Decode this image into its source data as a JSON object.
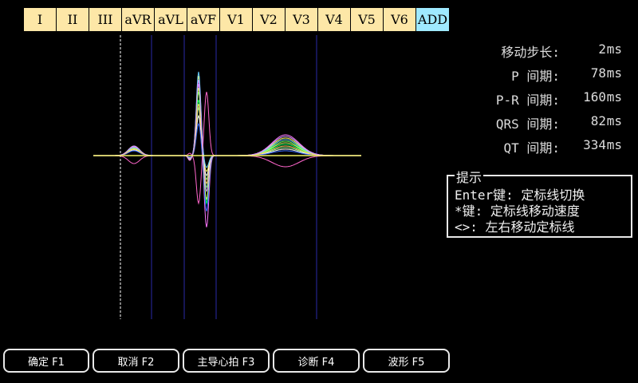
{
  "leads": {
    "tabs": [
      "I",
      "II",
      "III",
      "aVR",
      "aVL",
      "aVF",
      "V1",
      "V2",
      "V3",
      "V4",
      "V5",
      "V6",
      "ADD"
    ],
    "active": "ADD"
  },
  "measurements": [
    {
      "label": "移动步长:",
      "value": "2",
      "unit": "ms"
    },
    {
      "label": "P 间期:",
      "value": "78",
      "unit": "ms"
    },
    {
      "label": "P-R 间期:",
      "value": "160",
      "unit": "ms"
    },
    {
      "label": "QRS 间期:",
      "value": "82",
      "unit": "ms"
    },
    {
      "label": "QT 间期:",
      "value": "334",
      "unit": "ms"
    }
  ],
  "hint": {
    "title": "提示",
    "lines": [
      "Enter键: 定标线切换",
      "*键: 定标线移动速度",
      "<>: 左右移动定标线"
    ]
  },
  "buttons": [
    {
      "label": "确定 F1"
    },
    {
      "label": "取消 F2"
    },
    {
      "label": "主导心拍 F3"
    },
    {
      "label": "诊断 F4"
    },
    {
      "label": "波形 F5"
    }
  ],
  "colors": {
    "tab_bg": "#fde7a7",
    "tab_active_bg": "#9fe9ff",
    "marker_line": "#2a2aa8",
    "cursor_line": "#ffffff",
    "baseline": "#ffff66",
    "trace_colors": [
      "#ffff55",
      "#66ff66",
      "#00ff66",
      "#99ff99",
      "#ff77ff",
      "#ffffff",
      "#66ccff",
      "#3366ff",
      "#ff66cc",
      "#ccff66",
      "#ffcc66",
      "#cc99ff"
    ]
  }
}
